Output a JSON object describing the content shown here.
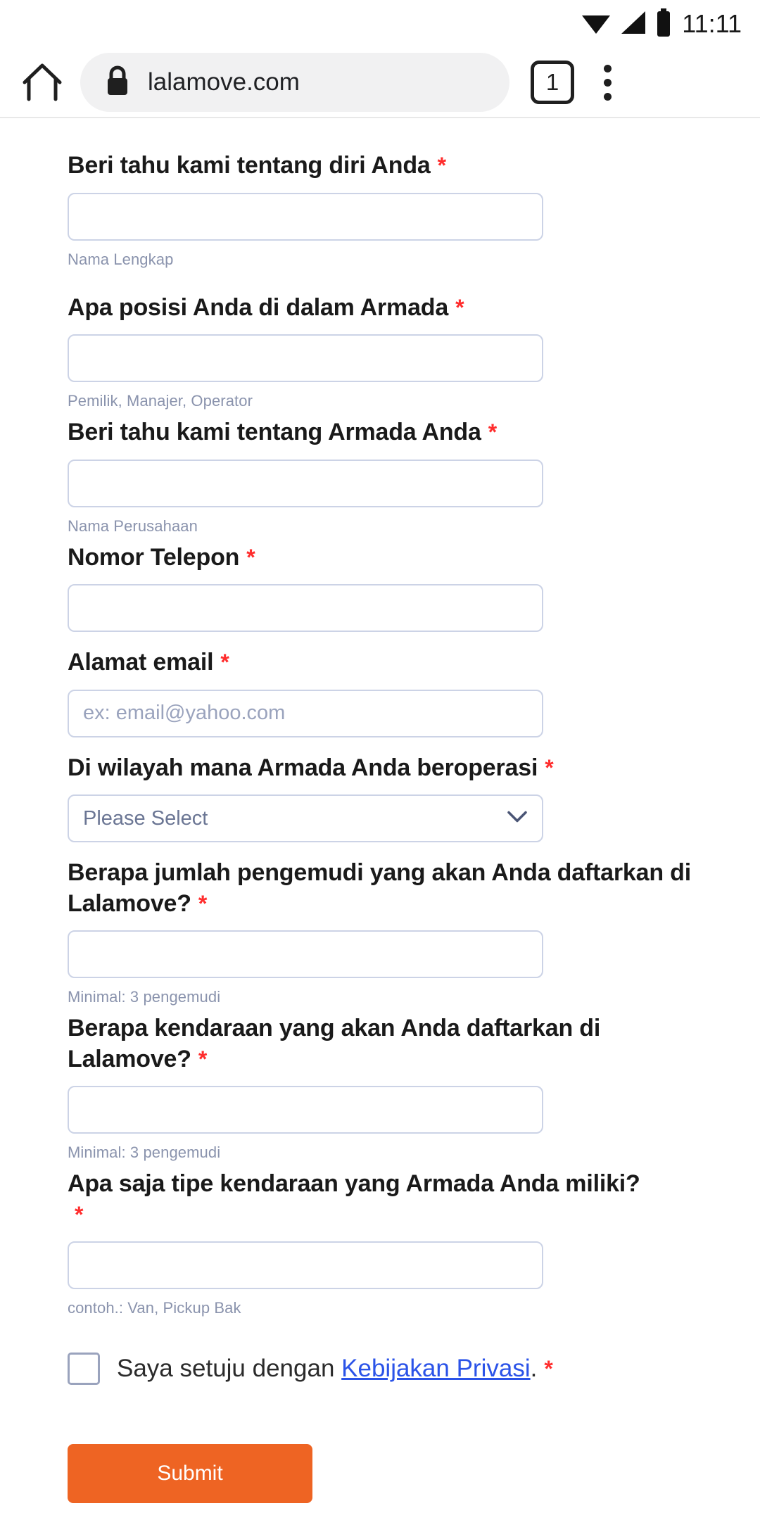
{
  "status_bar": {
    "time": "11:11",
    "icons": [
      "wifi-icon",
      "signal-icon",
      "battery-icon"
    ]
  },
  "browser": {
    "home_icon": "home-icon",
    "lock_icon": "lock-icon",
    "url": "lalamove.com",
    "tab_count": "1",
    "menu_icon": "overflow-menu-icon"
  },
  "form": {
    "fields": [
      {
        "label": "Beri tahu kami tentang diri Anda",
        "required": "*",
        "type": "text",
        "value": "",
        "placeholder": "",
        "helper": "Nama Lengkap"
      },
      {
        "label": "Apa posisi Anda di dalam Armada",
        "required": "*",
        "type": "text",
        "value": "",
        "placeholder": "",
        "helper": "Pemilik, Manajer, Operator"
      },
      {
        "label": "Beri tahu kami tentang Armada Anda",
        "required": "*",
        "type": "text",
        "value": "",
        "placeholder": "",
        "helper": "Nama Perusahaan"
      },
      {
        "label": "Nomor Telepon",
        "required": "*",
        "type": "text",
        "value": "",
        "placeholder": "",
        "helper": ""
      },
      {
        "label": "Alamat email",
        "required": "*",
        "type": "text",
        "value": "",
        "placeholder": "ex: email@yahoo.com",
        "helper": ""
      },
      {
        "label": "Di wilayah mana Armada Anda beroperasi",
        "required": "*",
        "type": "select",
        "value": "Please Select",
        "placeholder": "",
        "helper": ""
      },
      {
        "label": "Berapa jumlah pengemudi yang akan Anda daftarkan di Lalamove?",
        "required": "*",
        "type": "text",
        "value": "",
        "placeholder": "",
        "helper": "Minimal: 3 pengemudi"
      },
      {
        "label": "Berapa kendaraan yang akan Anda daftarkan di Lalamove?",
        "required": "*",
        "type": "text",
        "value": "",
        "placeholder": "",
        "helper": "Minimal: 3 pengemudi"
      },
      {
        "label": "Apa saja tipe kendaraan yang Armada Anda miliki?",
        "required": "*",
        "type": "text",
        "value": "",
        "placeholder": "",
        "helper": "contoh.: Van, Pickup Bak"
      }
    ],
    "consent": {
      "text_before": "Saya setuju dengan ",
      "link_text": "Kebijakan Privasi",
      "text_after": ".",
      "required": "*",
      "checked": false
    },
    "submit_label": "Submit"
  },
  "colors": {
    "accent": "#ee6423",
    "required": "#ff2d2d",
    "link": "#2b53e8",
    "input_border": "#ccd3e6",
    "helper_text": "#8a93ad"
  }
}
